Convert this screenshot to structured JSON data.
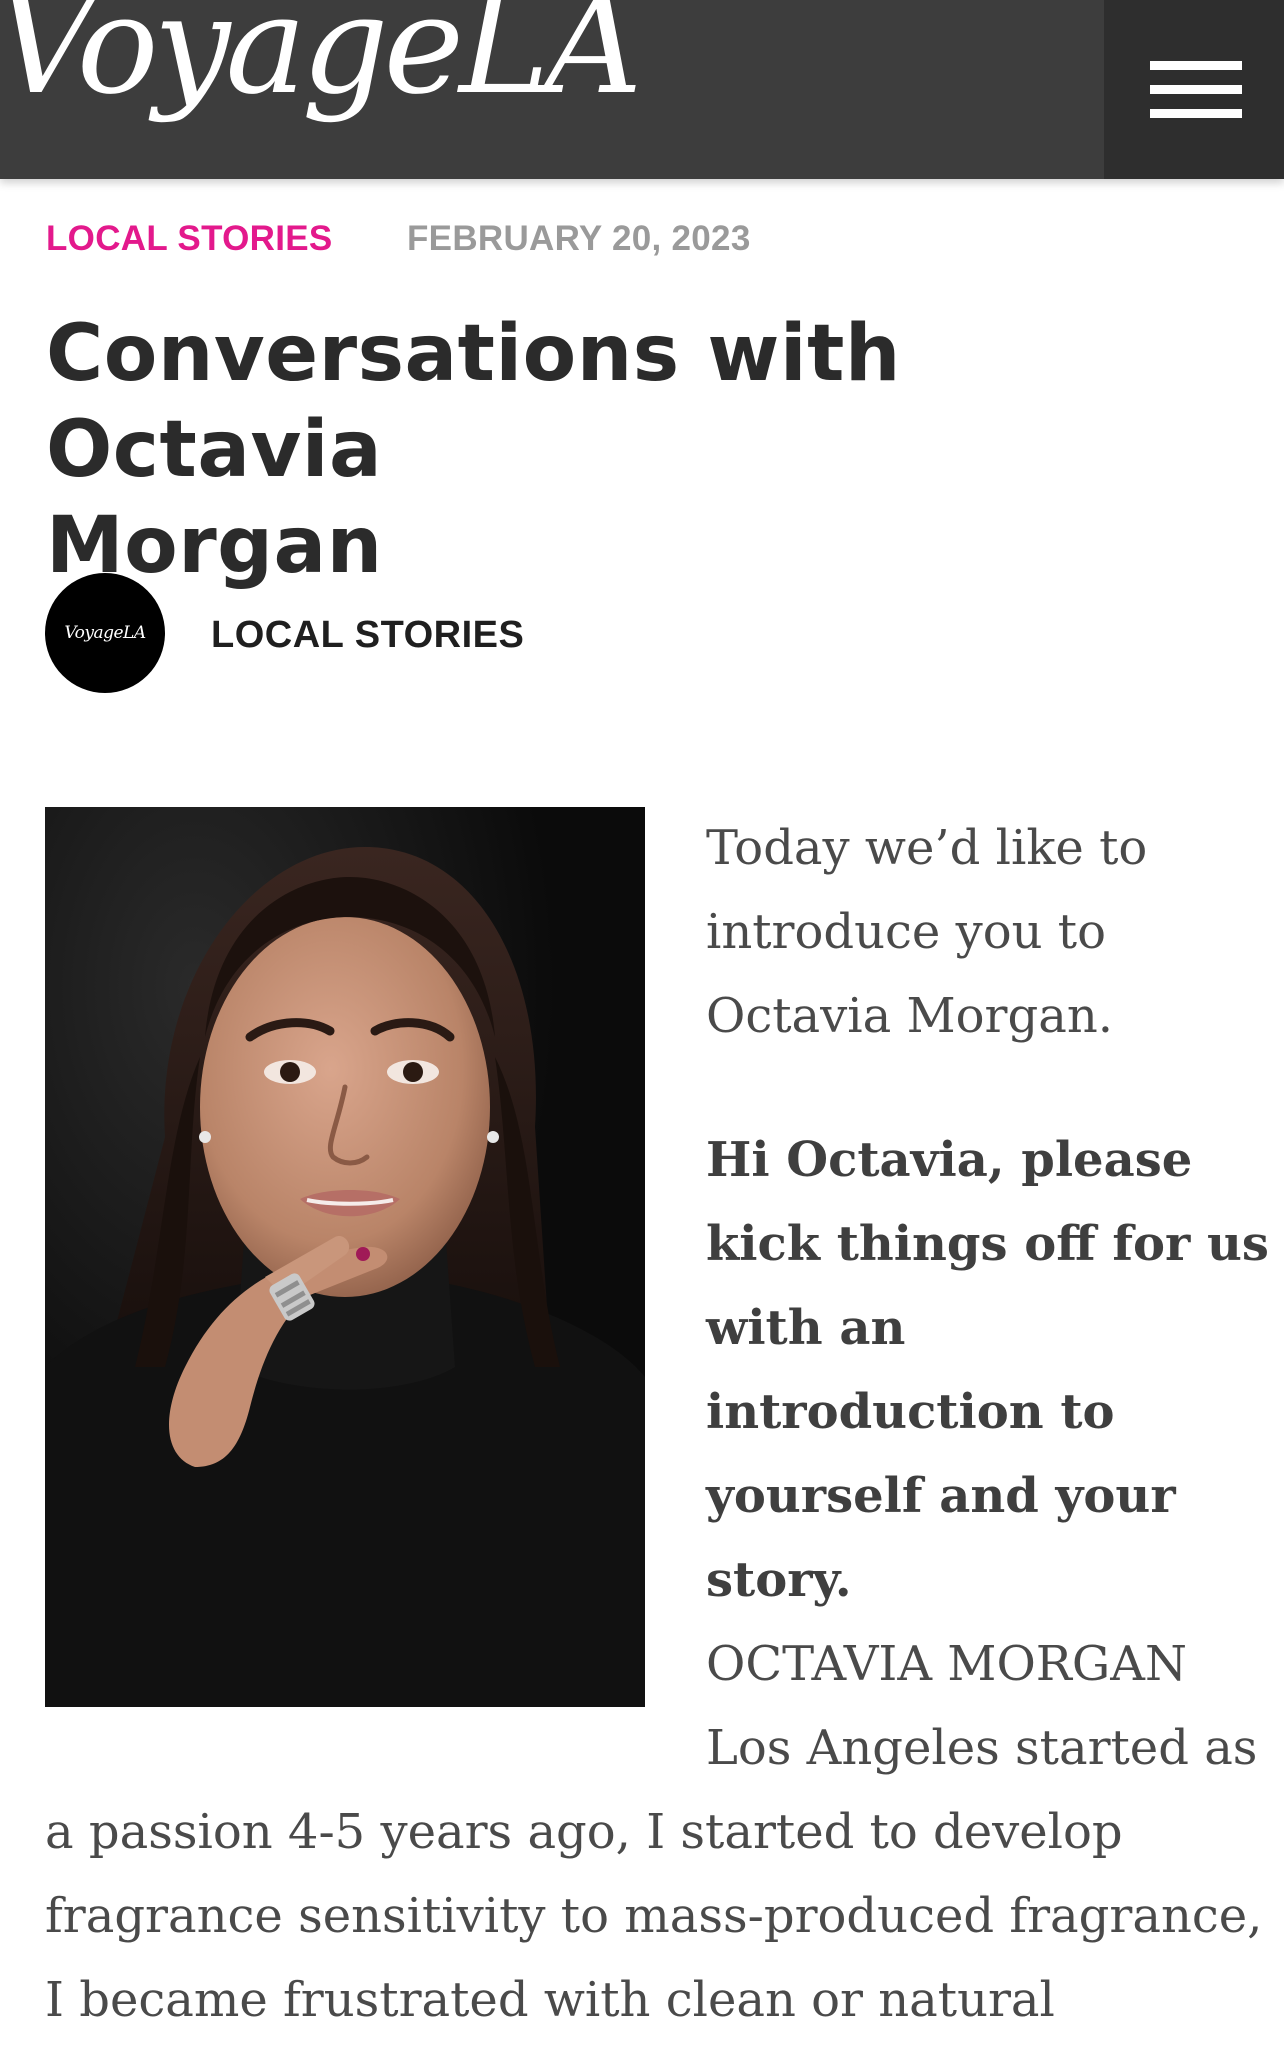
{
  "header": {
    "logo_text": "VoyageLA",
    "menu_icon": "hamburger-menu-icon"
  },
  "meta": {
    "category": "LOCAL STORIES",
    "date": "FEBRUARY 20, 2023"
  },
  "article": {
    "title_lines": [
      "Conversations with Octavia",
      "Morgan"
    ]
  },
  "author": {
    "avatar_text": "VoyageLA",
    "name": "LOCAL STORIES"
  },
  "portrait": {
    "alt": "Octavia Morgan"
  },
  "content": {
    "intro_lines": [
      "Today we’d like to",
      "introduce you to",
      "Octavia Morgan."
    ],
    "question_lines": [
      "Hi Octavia, please",
      "kick things off for us",
      "with an",
      "introduction to",
      "yourself and your",
      "story."
    ],
    "answer_side_lines": [
      "OCTAVIA MORGAN",
      "Los Angeles started as"
    ],
    "answer_full_lines": [
      "a passion 4-5 years ago, I started to develop",
      "fragrance sensitivity to mass-produced fragrance,",
      "I became frustrated with clean or natural"
    ]
  },
  "colors": {
    "header_bg": "#3d3d3d",
    "menu_bg": "#2e2e2e",
    "accent": "#e3198c",
    "date": "#9a9a9a",
    "title": "#2b2b2b",
    "body": "#4a4a4a"
  }
}
